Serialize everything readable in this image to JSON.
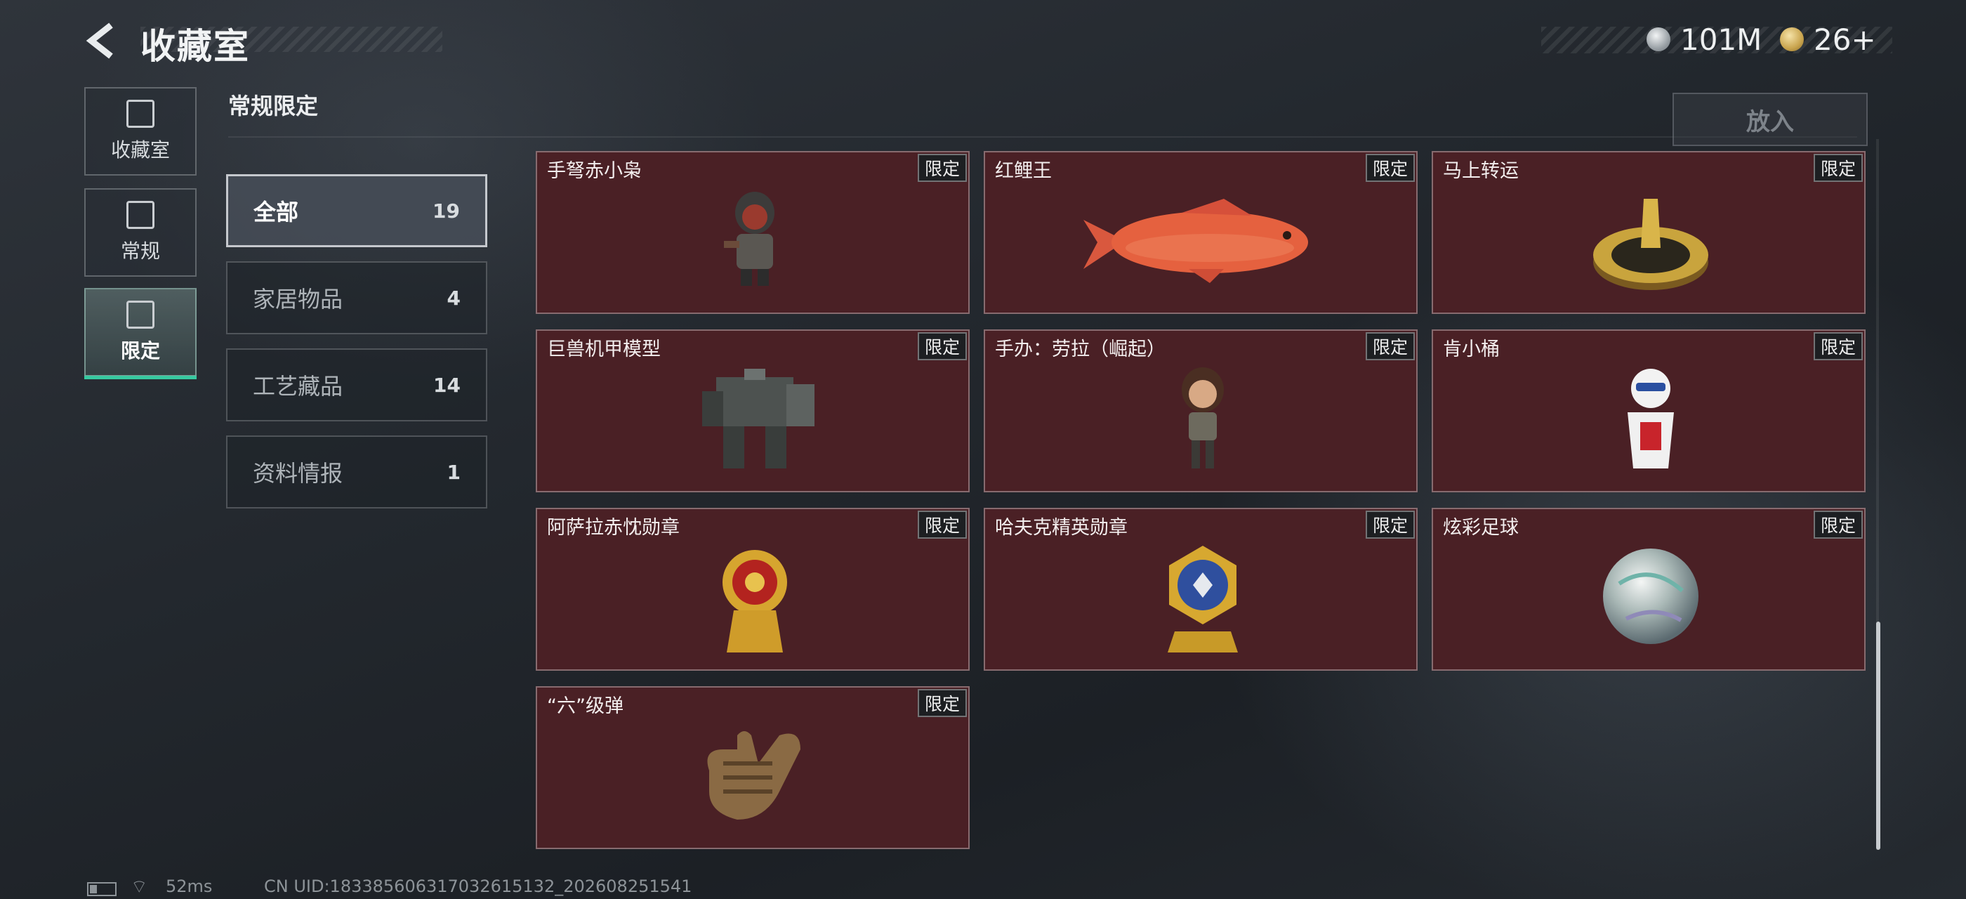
{
  "header": {
    "title": "收藏室",
    "currency_silver": "101M",
    "currency_gold": "26+"
  },
  "rail": [
    {
      "label": "收藏室",
      "icon": "trophy-icon"
    },
    {
      "label": "常规",
      "icon": "image-icon"
    },
    {
      "label": "限定",
      "icon": "limited-icon"
    }
  ],
  "section": {
    "title": "常规限定"
  },
  "put_button": "放入",
  "categories": [
    {
      "name": "全部",
      "count": "19"
    },
    {
      "name": "家居物品",
      "count": "4"
    },
    {
      "name": "工艺藏品",
      "count": "14"
    },
    {
      "name": "资料情报",
      "count": "1"
    }
  ],
  "items": [
    {
      "name": "手弩赤小枭",
      "tag": "限定"
    },
    {
      "name": "红鲤王",
      "tag": "限定"
    },
    {
      "name": "马上转运",
      "tag": "限定"
    },
    {
      "name": "巨兽机甲模型",
      "tag": "限定"
    },
    {
      "name": "手办：劳拉（崛起）",
      "tag": "限定"
    },
    {
      "name": "肯小桶",
      "tag": "限定"
    },
    {
      "name": "阿萨拉赤忱勋章",
      "tag": "限定"
    },
    {
      "name": "哈夫克精英勋章",
      "tag": "限定"
    },
    {
      "name": "炫彩足球",
      "tag": "限定"
    },
    {
      "name": "“六”级弹",
      "tag": "限定"
    }
  ],
  "status": {
    "ping": "52ms",
    "uid": "CN UID:18338560631703261513​2_202608251541"
  },
  "colors": {
    "card_bg": "#4a2025",
    "active_accent": "#37c9a0"
  }
}
